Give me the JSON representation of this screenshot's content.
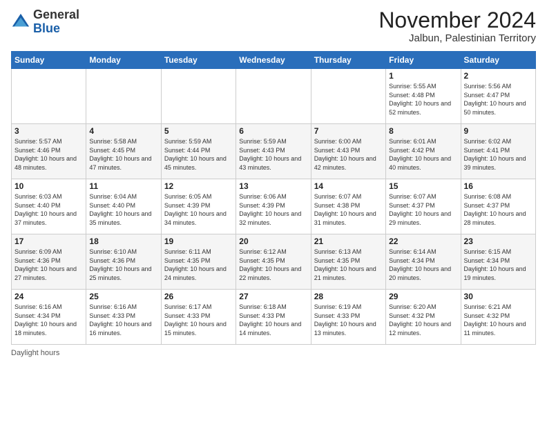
{
  "logo": {
    "general": "General",
    "blue": "Blue"
  },
  "title": {
    "month": "November 2024",
    "location": "Jalbun, Palestinian Territory"
  },
  "days_header": [
    "Sunday",
    "Monday",
    "Tuesday",
    "Wednesday",
    "Thursday",
    "Friday",
    "Saturday"
  ],
  "weeks": [
    [
      {
        "day": "",
        "info": ""
      },
      {
        "day": "",
        "info": ""
      },
      {
        "day": "",
        "info": ""
      },
      {
        "day": "",
        "info": ""
      },
      {
        "day": "",
        "info": ""
      },
      {
        "day": "1",
        "info": "Sunrise: 5:55 AM\nSunset: 4:48 PM\nDaylight: 10 hours and 52 minutes."
      },
      {
        "day": "2",
        "info": "Sunrise: 5:56 AM\nSunset: 4:47 PM\nDaylight: 10 hours and 50 minutes."
      }
    ],
    [
      {
        "day": "3",
        "info": "Sunrise: 5:57 AM\nSunset: 4:46 PM\nDaylight: 10 hours and 48 minutes."
      },
      {
        "day": "4",
        "info": "Sunrise: 5:58 AM\nSunset: 4:45 PM\nDaylight: 10 hours and 47 minutes."
      },
      {
        "day": "5",
        "info": "Sunrise: 5:59 AM\nSunset: 4:44 PM\nDaylight: 10 hours and 45 minutes."
      },
      {
        "day": "6",
        "info": "Sunrise: 5:59 AM\nSunset: 4:43 PM\nDaylight: 10 hours and 43 minutes."
      },
      {
        "day": "7",
        "info": "Sunrise: 6:00 AM\nSunset: 4:43 PM\nDaylight: 10 hours and 42 minutes."
      },
      {
        "day": "8",
        "info": "Sunrise: 6:01 AM\nSunset: 4:42 PM\nDaylight: 10 hours and 40 minutes."
      },
      {
        "day": "9",
        "info": "Sunrise: 6:02 AM\nSunset: 4:41 PM\nDaylight: 10 hours and 39 minutes."
      }
    ],
    [
      {
        "day": "10",
        "info": "Sunrise: 6:03 AM\nSunset: 4:40 PM\nDaylight: 10 hours and 37 minutes."
      },
      {
        "day": "11",
        "info": "Sunrise: 6:04 AM\nSunset: 4:40 PM\nDaylight: 10 hours and 35 minutes."
      },
      {
        "day": "12",
        "info": "Sunrise: 6:05 AM\nSunset: 4:39 PM\nDaylight: 10 hours and 34 minutes."
      },
      {
        "day": "13",
        "info": "Sunrise: 6:06 AM\nSunset: 4:39 PM\nDaylight: 10 hours and 32 minutes."
      },
      {
        "day": "14",
        "info": "Sunrise: 6:07 AM\nSunset: 4:38 PM\nDaylight: 10 hours and 31 minutes."
      },
      {
        "day": "15",
        "info": "Sunrise: 6:07 AM\nSunset: 4:37 PM\nDaylight: 10 hours and 29 minutes."
      },
      {
        "day": "16",
        "info": "Sunrise: 6:08 AM\nSunset: 4:37 PM\nDaylight: 10 hours and 28 minutes."
      }
    ],
    [
      {
        "day": "17",
        "info": "Sunrise: 6:09 AM\nSunset: 4:36 PM\nDaylight: 10 hours and 27 minutes."
      },
      {
        "day": "18",
        "info": "Sunrise: 6:10 AM\nSunset: 4:36 PM\nDaylight: 10 hours and 25 minutes."
      },
      {
        "day": "19",
        "info": "Sunrise: 6:11 AM\nSunset: 4:35 PM\nDaylight: 10 hours and 24 minutes."
      },
      {
        "day": "20",
        "info": "Sunrise: 6:12 AM\nSunset: 4:35 PM\nDaylight: 10 hours and 22 minutes."
      },
      {
        "day": "21",
        "info": "Sunrise: 6:13 AM\nSunset: 4:35 PM\nDaylight: 10 hours and 21 minutes."
      },
      {
        "day": "22",
        "info": "Sunrise: 6:14 AM\nSunset: 4:34 PM\nDaylight: 10 hours and 20 minutes."
      },
      {
        "day": "23",
        "info": "Sunrise: 6:15 AM\nSunset: 4:34 PM\nDaylight: 10 hours and 19 minutes."
      }
    ],
    [
      {
        "day": "24",
        "info": "Sunrise: 6:16 AM\nSunset: 4:34 PM\nDaylight: 10 hours and 18 minutes."
      },
      {
        "day": "25",
        "info": "Sunrise: 6:16 AM\nSunset: 4:33 PM\nDaylight: 10 hours and 16 minutes."
      },
      {
        "day": "26",
        "info": "Sunrise: 6:17 AM\nSunset: 4:33 PM\nDaylight: 10 hours and 15 minutes."
      },
      {
        "day": "27",
        "info": "Sunrise: 6:18 AM\nSunset: 4:33 PM\nDaylight: 10 hours and 14 minutes."
      },
      {
        "day": "28",
        "info": "Sunrise: 6:19 AM\nSunset: 4:33 PM\nDaylight: 10 hours and 13 minutes."
      },
      {
        "day": "29",
        "info": "Sunrise: 6:20 AM\nSunset: 4:32 PM\nDaylight: 10 hours and 12 minutes."
      },
      {
        "day": "30",
        "info": "Sunrise: 6:21 AM\nSunset: 4:32 PM\nDaylight: 10 hours and 11 minutes."
      }
    ]
  ],
  "footer": {
    "daylight_label": "Daylight hours"
  }
}
